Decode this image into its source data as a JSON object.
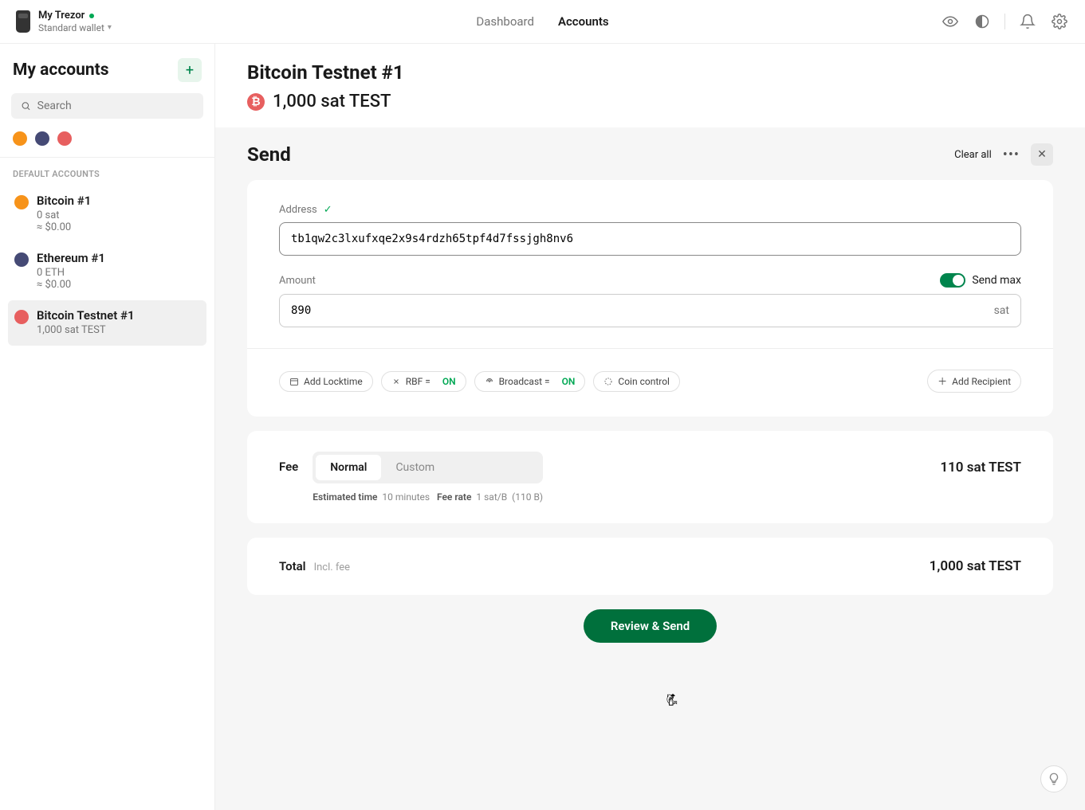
{
  "device": {
    "name": "My Trezor",
    "wallet_type": "Standard wallet"
  },
  "nav": {
    "dashboard": "Dashboard",
    "accounts": "Accounts"
  },
  "sidebar": {
    "title": "My accounts",
    "search_placeholder": "Search",
    "section_label": "DEFAULT ACCOUNTS",
    "accounts": [
      {
        "name": "Bitcoin #1",
        "balance": "0 sat",
        "fiat": "≈ $0.00"
      },
      {
        "name": "Ethereum #1",
        "balance": "0 ETH",
        "fiat": "≈ $0.00"
      },
      {
        "name": "Bitcoin Testnet #1",
        "balance": "1,000 sat TEST",
        "fiat": ""
      }
    ]
  },
  "page": {
    "title": "Bitcoin Testnet #1",
    "balance": "1,000 sat TEST"
  },
  "send": {
    "title": "Send",
    "clear": "Clear all",
    "address_label": "Address",
    "address_value": "tb1qw2c3lxufxqe2x9s4rdzh65tpf4d7fssjgh8nv6",
    "amount_label": "Amount",
    "sendmax_label": "Send max",
    "amount_value": "890",
    "amount_unit": "sat",
    "options": {
      "locktime": "Add Locktime",
      "rbf_label": "RBF =",
      "rbf_value": "ON",
      "broadcast_label": "Broadcast =",
      "broadcast_value": "ON",
      "coin_control": "Coin control",
      "add_recipient": "Add Recipient"
    },
    "fee": {
      "label": "Fee",
      "normal": "Normal",
      "custom": "Custom",
      "value": "110 sat TEST",
      "est_label": "Estimated time",
      "est_value": "10 minutes",
      "rate_label": "Fee rate",
      "rate_value": "1 sat/B",
      "size": "(110 B)"
    },
    "total": {
      "label": "Total",
      "incl": "Incl. fee",
      "value": "1,000 sat TEST"
    },
    "submit": "Review & Send"
  }
}
